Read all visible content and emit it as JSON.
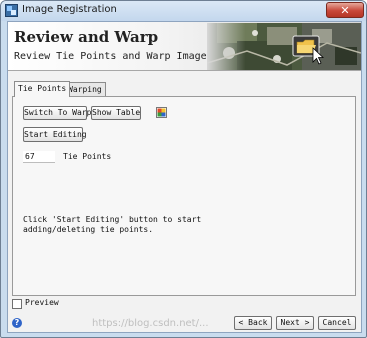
{
  "window": {
    "title": "Image Registration",
    "close_glyph": "✕"
  },
  "header": {
    "title": "Review and Warp",
    "subtitle": "Review Tie Points and Warp Image"
  },
  "tabs": [
    {
      "label": "Tie Points",
      "active": true
    },
    {
      "label": "Warping",
      "active": false
    }
  ],
  "panel": {
    "switch_button": "Switch To Warp",
    "table_button": "Show Table",
    "editing_button": "Start Editing",
    "tie_points_count": "67",
    "tie_points_label": "Tie Points",
    "hint_text": "Click 'Start Editing' button to start adding/deleting tie points."
  },
  "preview": {
    "label": "Preview",
    "checked": false
  },
  "footer": {
    "help_glyph": "?",
    "back": "< Back",
    "next": "Next >",
    "cancel": "Cancel"
  },
  "watermark": "https://blog.csdn.net/..."
}
